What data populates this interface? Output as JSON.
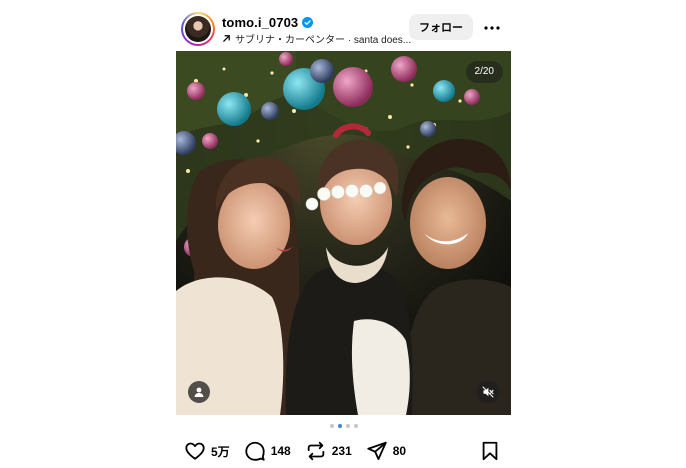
{
  "header": {
    "username": "tomo.i_0703",
    "verified": true,
    "audio_label": "サブリナ・カーペンター · santa does...",
    "follow_label": "フォロー"
  },
  "media": {
    "counter": "2/20",
    "carousel_active_index": 1,
    "carousel_visible_dots": 4
  },
  "actions": {
    "likes": "5万",
    "comments": "148",
    "reposts": "231",
    "shares": "80"
  },
  "icons": [
    "verified-badge-icon",
    "audio-arrow-icon",
    "more-icon",
    "user-tag-icon",
    "mute-icon",
    "heart-icon",
    "comment-icon",
    "repost-icon",
    "share-icon",
    "bookmark-icon"
  ],
  "colors": {
    "verified": "#0095f6",
    "active_dot": "#3b82f6",
    "follow_button_bg": "#efefef"
  }
}
